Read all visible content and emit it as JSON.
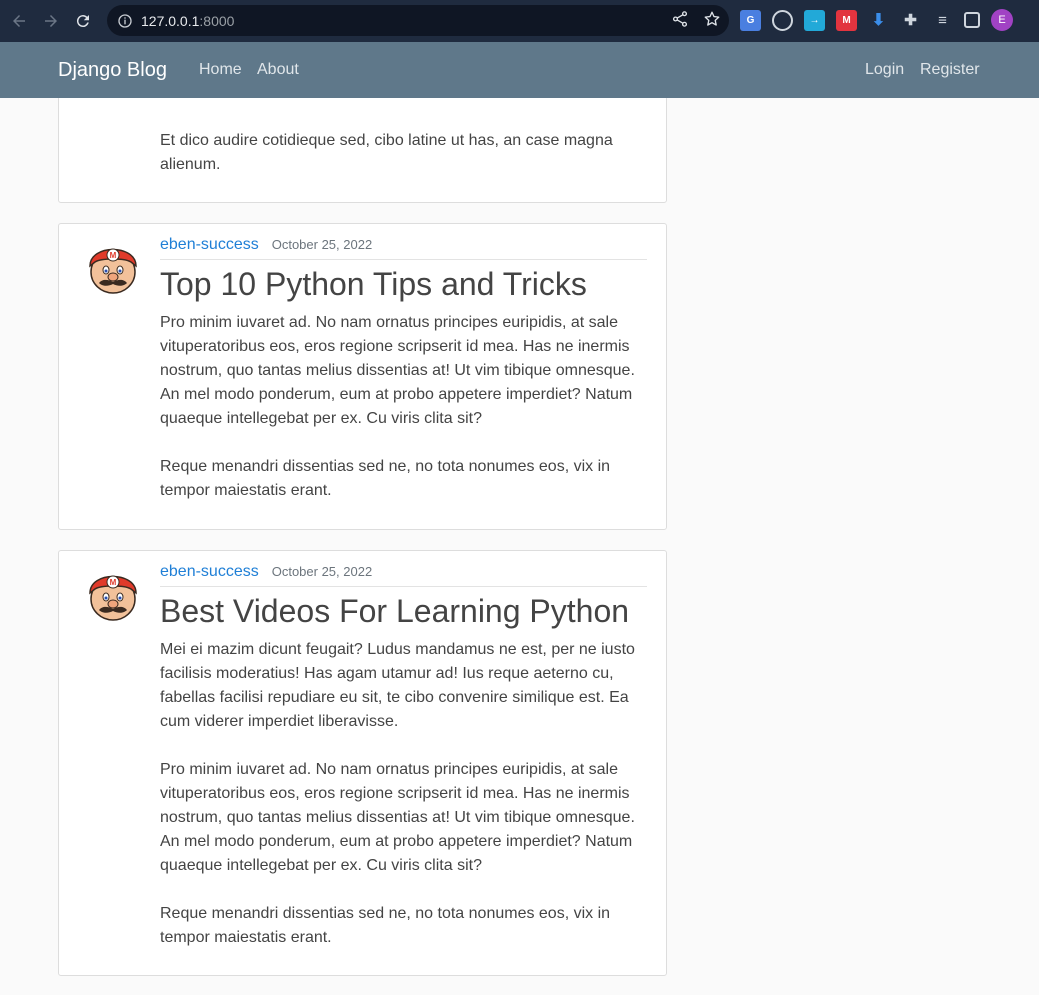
{
  "browser": {
    "url_host": "127.0.0.1",
    "url_port": ":8000",
    "profile_initial": "E"
  },
  "navbar": {
    "brand": "Django Blog",
    "links": [
      "Home",
      "About"
    ],
    "auth_links": [
      "Login",
      "Register"
    ]
  },
  "posts": [
    {
      "paragraphs": [
        "Et dico audire cotidieque sed, cibo latine ut has, an case magna alienum."
      ]
    },
    {
      "author": "eben-success",
      "date": "October 25, 2022",
      "title": "Top 10 Python Tips and Tricks",
      "paragraphs": [
        "Pro minim iuvaret ad. No nam ornatus principes euripidis, at sale vituperatoribus eos, eros regione scripserit id mea. Has ne inermis nostrum, quo tantas melius dissentias at! Ut vim tibique omnesque. An mel modo ponderum, eum at probo appetere imperdiet? Natum quaeque intellegebat per ex. Cu viris clita sit?",
        "Reque menandri dissentias sed ne, no tota nonumes eos, vix in tempor maiestatis erant."
      ]
    },
    {
      "author": "eben-success",
      "date": "October 25, 2022",
      "title": "Best Videos For Learning Python",
      "paragraphs": [
        "Mei ei mazim dicunt feugait? Ludus mandamus ne est, per ne iusto facilisis moderatius! Has agam utamur ad! Ius reque aeterno cu, fabellas facilisi repudiare eu sit, te cibo convenire similique est. Ea cum viderer imperdiet liberavisse.",
        "Pro minim iuvaret ad. No nam ornatus principes euripidis, at sale vituperatoribus eos, eros regione scripserit id mea. Has ne inermis nostrum, quo tantas melius dissentias at! Ut vim tibique omnesque. An mel modo ponderum, eum at probo appetere imperdiet? Natum quaeque intellegebat per ex. Cu viris clita sit?",
        "Reque menandri dissentias sed ne, no tota nonumes eos, vix in tempor maiestatis erant."
      ]
    }
  ]
}
